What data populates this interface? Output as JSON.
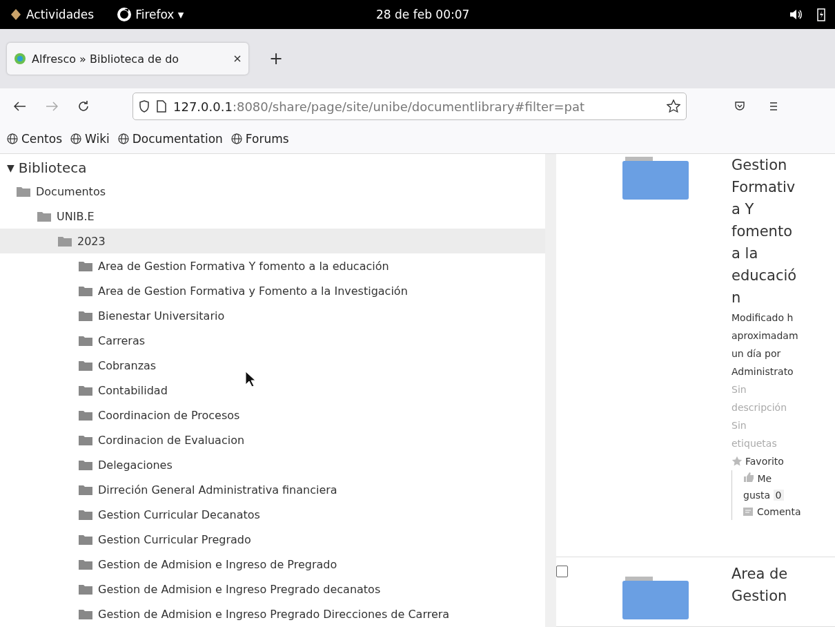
{
  "system_bar": {
    "activities": "Actividades",
    "app": "Firefox",
    "app_caret": "▾",
    "clock": "28 de feb  00:07"
  },
  "tabs": [
    {
      "title": "Alfresco » Biblioteca de do",
      "selected": true
    }
  ],
  "new_tab": "+",
  "address_bar": {
    "host": "127.0.0.1",
    "path": ":8080/share/page/site/unibe/documentlibrary#filter=pat"
  },
  "bookmarks": [
    "Centos",
    "Wiki",
    "Documentation",
    "Forums"
  ],
  "tree": {
    "toggle": "▼",
    "label": "Biblioteca",
    "expanded": true,
    "children": [
      {
        "label": "Documentos",
        "selected": false,
        "children": [
          {
            "label": "UNIB.E",
            "selected": false,
            "children": [
              {
                "label": "2023",
                "selected": true,
                "children": [
                  {
                    "label": "Area de Gestion Formativa Y fomento a la educación",
                    "selected": false
                  },
                  {
                    "label": "Area de Gestion Formativa y Fomento a la Investigación",
                    "selected": false
                  },
                  {
                    "label": "Bienestar Universitario",
                    "selected": false
                  },
                  {
                    "label": "Carreras",
                    "selected": false
                  },
                  {
                    "label": "Cobranzas",
                    "selected": false
                  },
                  {
                    "label": "Contabilidad",
                    "selected": false
                  },
                  {
                    "label": "Coordinacion de Procesos",
                    "selected": false
                  },
                  {
                    "label": "Cordinacion de Evaluacion",
                    "selected": false
                  },
                  {
                    "label": "Delegaciones",
                    "selected": false
                  },
                  {
                    "label": "Dirreción General Administrativa financiera",
                    "selected": false
                  },
                  {
                    "label": "Gestion Curricular Decanatos",
                    "selected": false
                  },
                  {
                    "label": "Gestion Curricular Pregrado",
                    "selected": false
                  },
                  {
                    "label": "Gestion de Admision e Ingreso de Pregrado",
                    "selected": false
                  },
                  {
                    "label": "Gestion de Admision e Ingreso Pregrado decanatos",
                    "selected": false
                  },
                  {
                    "label": "Gestion de Admision e Ingreso Pregrado Direcciones de Carrera",
                    "selected": false
                  }
                ]
              }
            ]
          }
        ]
      }
    ]
  },
  "documents": [
    {
      "title": "Gestion Formativa Y fomento a la educación",
      "meta": [
        "Modificado h",
        "aproximadam",
        "un día por",
        "Administrato"
      ],
      "description": [
        "Sin",
        "descripción"
      ],
      "tags": [
        "Sin",
        "etiquetas"
      ],
      "favorite": "Favorito",
      "like": [
        "Me",
        "gusta"
      ],
      "like_count": "0",
      "comment": "Comenta"
    },
    {
      "checked": false,
      "title": "Area de Gestion"
    }
  ]
}
